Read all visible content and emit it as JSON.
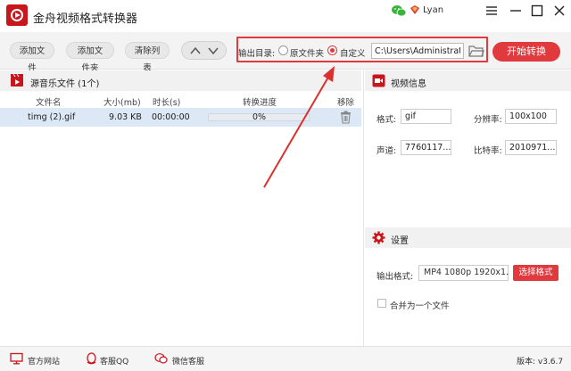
{
  "app": {
    "title": "金舟视频格式转换器",
    "user_name": "Lyan"
  },
  "toolbar": {
    "add_file": "添加文件",
    "add_folder": "添加文件夹",
    "clear_list": "清除列表",
    "output_dir_label": "输出目录:",
    "radio_original": "原文件夹",
    "radio_custom": "自定义",
    "output_path": "C:\\Users\\Administrator",
    "start_button": "开始转换"
  },
  "file_list": {
    "title": "源音乐文件 (1个)",
    "columns": [
      "文件名",
      "大小(mb)",
      "时长(s)",
      "转换进度",
      "移除"
    ],
    "rows": [
      {
        "name": "timg (2).gif",
        "size": "9.03 KB",
        "duration": "00:00:00",
        "progress_label": "0%",
        "progress": 0
      }
    ]
  },
  "video_info": {
    "title": "视频信息",
    "format_label": "格式:",
    "format_value": "gif",
    "resolution_label": "分辨率:",
    "resolution_value": "100x100",
    "channel_label": "声道:",
    "channel_value": "7760117...",
    "bitrate_label": "比特率:",
    "bitrate_value": "2010971..."
  },
  "settings": {
    "title": "设置",
    "output_format_label": "输出格式:",
    "output_format_value": "MP4 1080p 1920x1...",
    "choose_format_button": "选择格式",
    "merge_label": "合并为一个文件"
  },
  "footer": {
    "website": "官方网站",
    "qq": "客服QQ",
    "wechat": "微信客服",
    "version": "版本: v3.6.7"
  },
  "colors": {
    "accent": "#e0393e",
    "selected_row": "#dce8f5",
    "progress": "#7aa7de"
  }
}
